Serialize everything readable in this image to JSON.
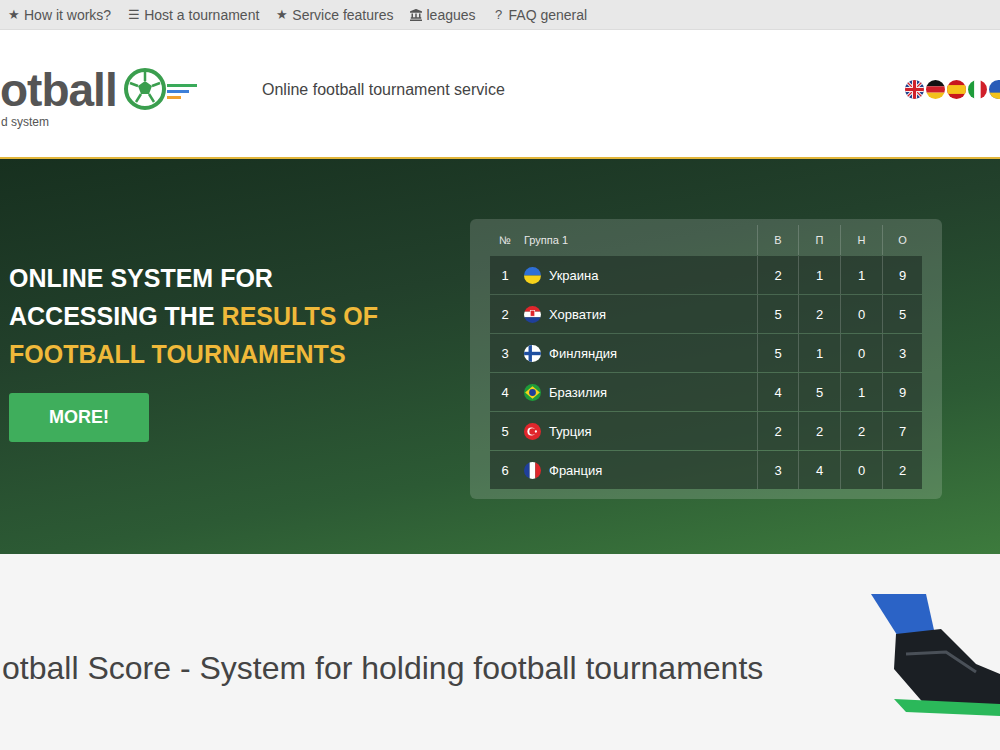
{
  "nav": {
    "items": [
      {
        "kind": "glyph",
        "icon": "★",
        "label": "How it works?"
      },
      {
        "kind": "glyph",
        "icon": "☰",
        "label": "Host a tournament"
      },
      {
        "kind": "glyph",
        "icon": "★",
        "label": "Service features"
      },
      {
        "kind": "landmark",
        "label": "leagues"
      },
      {
        "kind": "glyph",
        "icon": "?",
        "label": "FAQ general"
      }
    ]
  },
  "logo": {
    "text": "otball",
    "subtitle": "d system"
  },
  "tagline": "Online football tournament service",
  "languages": [
    {
      "kind": "en"
    },
    {
      "kind": "de"
    },
    {
      "kind": "es"
    },
    {
      "kind": "it"
    },
    {
      "kind": "partial"
    }
  ],
  "hero": {
    "title_lines": [
      [
        {
          "text": "ONLINE SYSTEM FOR",
          "highlight": false
        }
      ],
      [
        {
          "text": "ACCESSING THE",
          "highlight": false
        },
        {
          "text": "RESULTS OF",
          "highlight": true
        }
      ],
      [
        {
          "text": "FOOTBALL TOURNAMENTS",
          "highlight": true
        }
      ]
    ],
    "button": "MORE!"
  },
  "standings": {
    "columns": [
      "№",
      "Группа 1",
      "В",
      "П",
      "Н",
      "О"
    ],
    "rows": [
      {
        "rank": "1",
        "team": "Украина",
        "kind": "ua",
        "values": [
          "2",
          "1",
          "1",
          "9"
        ]
      },
      {
        "rank": "2",
        "team": "Хорватия",
        "kind": "hr",
        "values": [
          "5",
          "2",
          "0",
          "5"
        ]
      },
      {
        "rank": "3",
        "team": "Финляндия",
        "kind": "fi",
        "values": [
          "5",
          "1",
          "0",
          "3"
        ]
      },
      {
        "rank": "4",
        "team": "Бразилия",
        "kind": "br",
        "values": [
          "4",
          "5",
          "1",
          "9"
        ]
      },
      {
        "rank": "5",
        "team": "Турция",
        "kind": "tr",
        "values": [
          "2",
          "2",
          "2",
          "7"
        ]
      },
      {
        "rank": "6",
        "team": "Франция",
        "kind": "fr",
        "values": [
          "3",
          "4",
          "0",
          "2"
        ]
      }
    ]
  },
  "section": {
    "heading": "otball Score - System for holding football tournaments"
  }
}
